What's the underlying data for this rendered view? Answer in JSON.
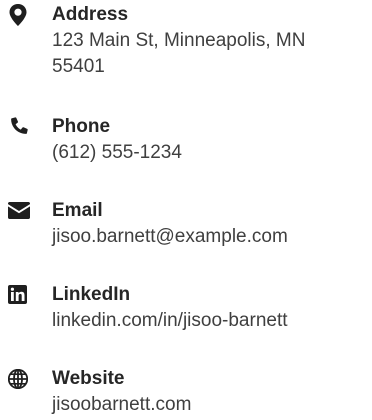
{
  "contacts": {
    "address": {
      "icon": "map-marker-icon",
      "label": "Address",
      "line1": "123 Main St, Minneapolis, MN",
      "line2": "55401"
    },
    "phone": {
      "icon": "phone-icon",
      "label": "Phone",
      "value": "(612) 555-1234"
    },
    "email": {
      "icon": "envelope-icon",
      "label": "Email",
      "value": "jisoo.barnett@example.com"
    },
    "linkedin": {
      "icon": "linkedin-icon",
      "label": "LinkedIn",
      "value": "linkedin.com/in/jisoo-barnett"
    },
    "website": {
      "icon": "globe-icon",
      "label": "Website",
      "value": "jisoobarnett.com"
    }
  },
  "colors": {
    "icon": "#1f1f1f",
    "label": "#262626",
    "value": "#3f3f3f",
    "background": "#ffffff"
  }
}
